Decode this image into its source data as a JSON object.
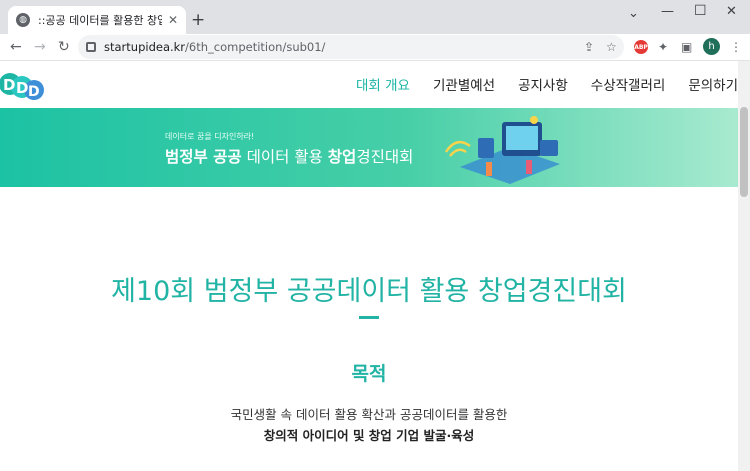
{
  "browser": {
    "tab_title": "::공공 데이터를 활용한 창업 경진",
    "tab_close": "✕",
    "new_tab": "+",
    "url_host": "startupidea.kr",
    "url_path": "/6th_competition/sub01/",
    "profile_initial": "h",
    "abp_label": "ABP"
  },
  "site": {
    "nav": [
      {
        "label": "대회 개요"
      },
      {
        "label": "기관별예선"
      },
      {
        "label": "공지사항"
      },
      {
        "label": "수상작갤러리"
      },
      {
        "label": "문의하기"
      }
    ],
    "banner": {
      "small": "데이터로 꿈을 디자인하라!",
      "title_b1": "범정부 공공",
      "title_t1": "데이터 활용 ",
      "title_b2": "창업",
      "title_t2": "경진대회"
    },
    "main_title": "제10회 범정부 공공데이터 활용 창업경진대회",
    "section_title": "목적",
    "desc_line1": "국민생활 속 데이터 활용 확산과 공공데이터를 활용한",
    "desc_line2": "창의적 아이디어 및 창업 기업 발굴·육성"
  },
  "colors": {
    "accent": "#21b3a4",
    "banner": "#1cc2a4"
  }
}
